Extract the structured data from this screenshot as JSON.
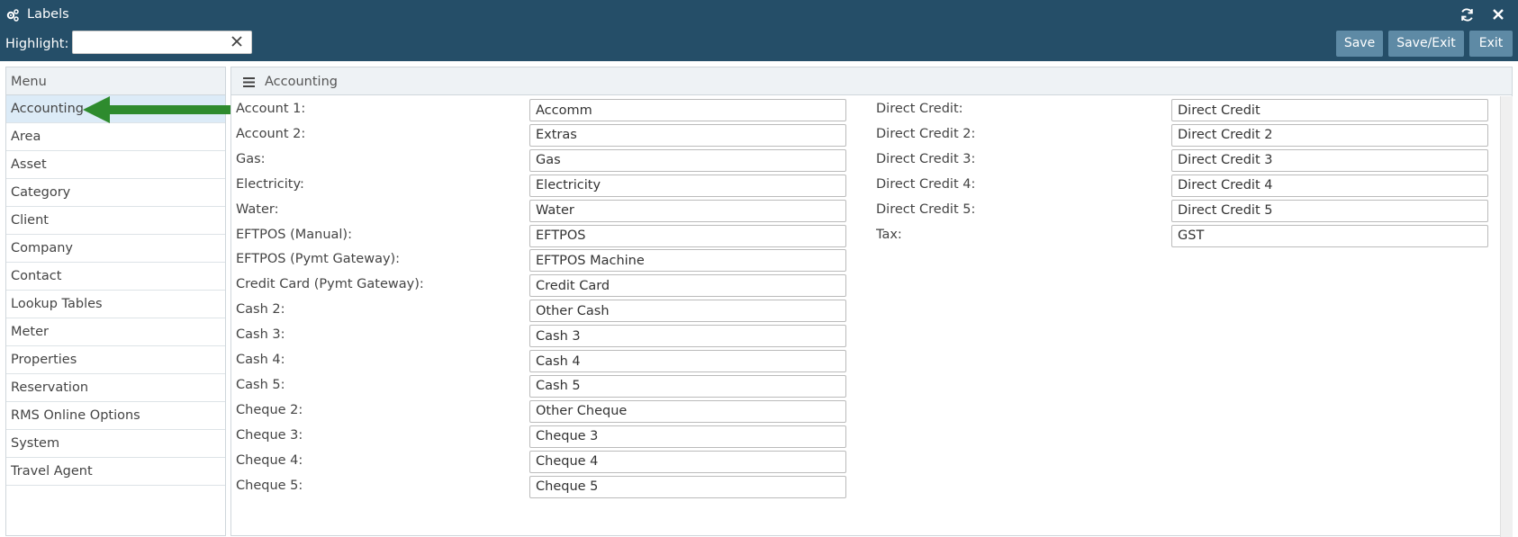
{
  "window": {
    "title": "Labels"
  },
  "toolbar": {
    "highlight_label": "Highlight:",
    "highlight_value": "",
    "save_label": "Save",
    "save_exit_label": "Save/Exit",
    "exit_label": "Exit"
  },
  "sidebar": {
    "header": "Menu",
    "items": [
      {
        "label": "Accounting",
        "active": true
      },
      {
        "label": "Area"
      },
      {
        "label": "Asset"
      },
      {
        "label": "Category"
      },
      {
        "label": "Client"
      },
      {
        "label": "Company"
      },
      {
        "label": "Contact"
      },
      {
        "label": "Lookup Tables"
      },
      {
        "label": "Meter"
      },
      {
        "label": "Properties"
      },
      {
        "label": "Reservation"
      },
      {
        "label": "RMS Online Options"
      },
      {
        "label": "System"
      },
      {
        "label": "Travel Agent"
      }
    ]
  },
  "main": {
    "title": "Accounting",
    "left_fields": [
      {
        "label": "Account 1:",
        "value": "Accomm"
      },
      {
        "label": "Account 2:",
        "value": "Extras"
      },
      {
        "label": "Gas:",
        "value": "Gas"
      },
      {
        "label": "Electricity:",
        "value": "Electricity"
      },
      {
        "label": "Water:",
        "value": "Water"
      },
      {
        "label": "EFTPOS (Manual):",
        "value": "EFTPOS"
      },
      {
        "label": "EFTPOS (Pymt Gateway):",
        "value": "EFTPOS Machine"
      },
      {
        "label": "Credit Card (Pymt Gateway):",
        "value": "Credit Card"
      },
      {
        "label": "Cash 2:",
        "value": "Other Cash"
      },
      {
        "label": "Cash 3:",
        "value": "Cash 3"
      },
      {
        "label": "Cash 4:",
        "value": "Cash 4"
      },
      {
        "label": "Cash 5:",
        "value": "Cash 5"
      },
      {
        "label": "Cheque 2:",
        "value": "Other Cheque"
      },
      {
        "label": "Cheque 3:",
        "value": "Cheque 3"
      },
      {
        "label": "Cheque 4:",
        "value": "Cheque 4"
      },
      {
        "label": "Cheque 5:",
        "value": "Cheque 5"
      }
    ],
    "right_fields": [
      {
        "label": "Direct Credit:",
        "value": "Direct Credit"
      },
      {
        "label": "Direct Credit 2:",
        "value": "Direct Credit 2"
      },
      {
        "label": "Direct Credit 3:",
        "value": "Direct Credit 3"
      },
      {
        "label": "Direct Credit 4:",
        "value": "Direct Credit 4"
      },
      {
        "label": "Direct Credit 5:",
        "value": "Direct Credit 5"
      },
      {
        "label": "Tax:",
        "value": "GST"
      }
    ]
  },
  "colors": {
    "header_bg": "#254e68",
    "button_bg": "#5e8aa5",
    "active_item_bg": "#dcebf7",
    "arrow": "#2e8b2e"
  }
}
